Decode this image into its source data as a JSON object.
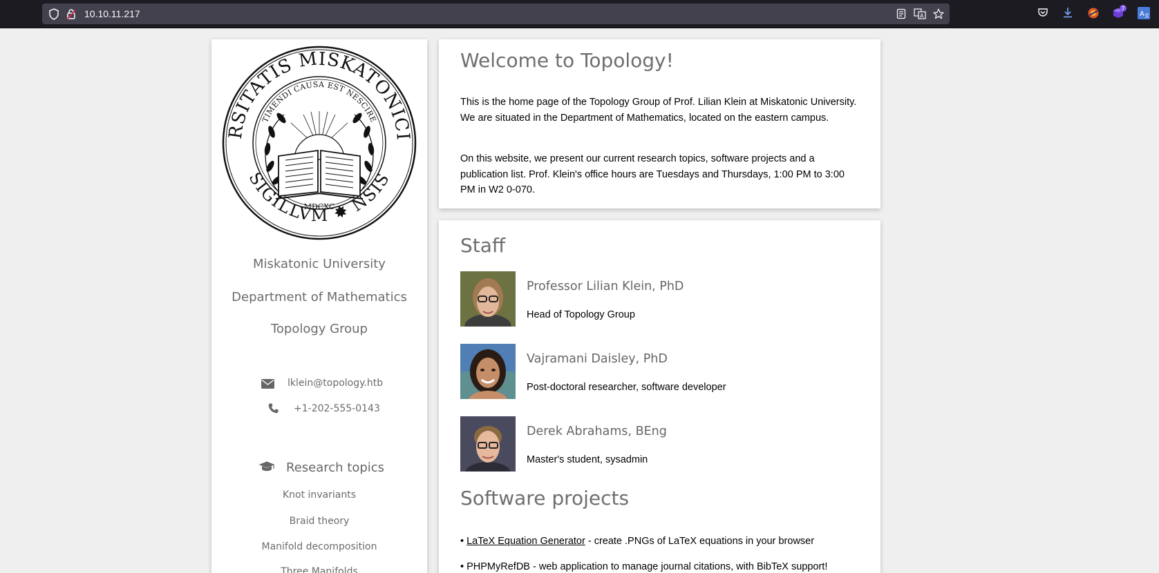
{
  "browser": {
    "url": "10.10.11.217",
    "extension_badge": "7",
    "icons": [
      "shield-icon",
      "lock-icon",
      "reader-view-icon",
      "translate-icon",
      "bookmark-star-icon",
      "pocket-icon",
      "downloads-icon",
      "extension-icon",
      "extension-icon",
      "translate-icon"
    ]
  },
  "sidebar": {
    "seal": {
      "outer_text": "UNIVERSITATIS MISKATONICIENSIS",
      "bottom_text": "SIGILLUM",
      "motto": "TIMENDI CAUSA EST NESCIRE",
      "year": "MDCXC"
    },
    "university": "Miskatonic University",
    "department": "Department of Mathematics",
    "group": "Topology Group",
    "email": "lklein@topology.htb",
    "phone": "+1-202-555-0143",
    "research_heading": "Research topics",
    "topics": [
      "Knot invariants",
      "Braid theory",
      "Manifold decomposition",
      "Three Manifolds"
    ]
  },
  "welcome": {
    "title": "Welcome to Topology!",
    "paragraph1": "This is the home page of the Topology Group of Prof. Lilian Klein at Miskatonic University. We are situated in the Department of Mathematics, located on the eastern campus.",
    "paragraph2": "On this website, we present our current research topics, software projects and a publication list. Prof. Klein's office hours are Tuesdays and Thursdays, 1:00 PM to 3:00 PM in W2 0-070."
  },
  "staff": {
    "title": "Staff",
    "members": [
      {
        "name": "Professor Lilian Klein, PhD",
        "role": "Head of Topology Group"
      },
      {
        "name": "Vajramani Daisley, PhD",
        "role": "Post-doctoral researcher, software developer"
      },
      {
        "name": "Derek Abrahams, BEng",
        "role": "Master's student, sysadmin"
      }
    ]
  },
  "software": {
    "title": "Software projects",
    "projects": [
      {
        "bullet": "•",
        "link": "LaTeX Equation Generator",
        "desc": " - create .PNGs of LaTeX equations in your browser"
      },
      {
        "bullet": "•",
        "link": "",
        "desc": "PHPMyRefDB - web application to manage journal citations, with BibTeX support!"
      }
    ]
  }
}
